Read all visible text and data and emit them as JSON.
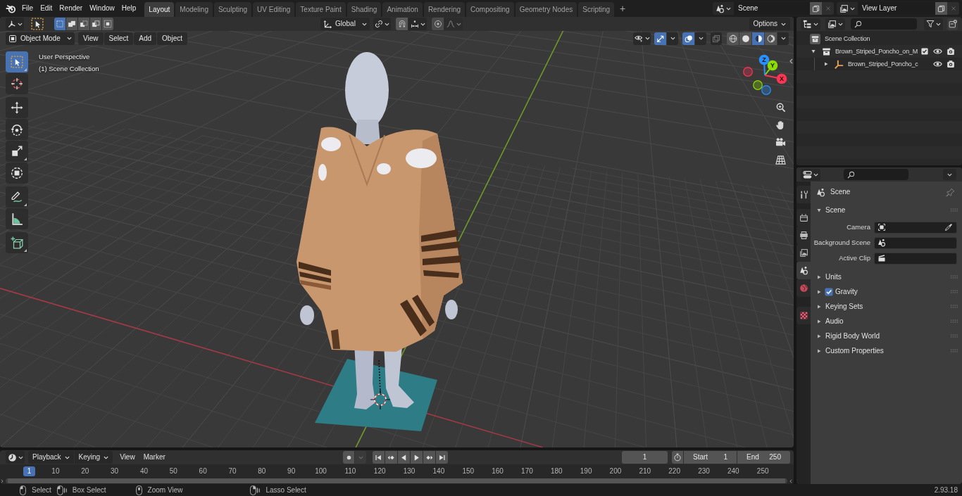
{
  "top_bar": {
    "menus": [
      "File",
      "Edit",
      "Render",
      "Window",
      "Help"
    ],
    "workspaces": [
      {
        "label": "Layout",
        "selected": true
      },
      {
        "label": "Modeling",
        "selected": false
      },
      {
        "label": "Sculpting",
        "selected": false
      },
      {
        "label": "UV Editing",
        "selected": false
      },
      {
        "label": "Texture Paint",
        "selected": false
      },
      {
        "label": "Shading",
        "selected": false
      },
      {
        "label": "Animation",
        "selected": false
      },
      {
        "label": "Rendering",
        "selected": false
      },
      {
        "label": "Compositing",
        "selected": false
      },
      {
        "label": "Geometry Nodes",
        "selected": false
      },
      {
        "label": "Scripting",
        "selected": false
      }
    ],
    "add_workspace": "+",
    "scene": "Scene",
    "view_layer": "View Layer"
  },
  "viewport": {
    "tool_header": {
      "select_modes": [
        {
          "kind": "set",
          "selected": true
        },
        {
          "kind": "extend",
          "selected": false
        },
        {
          "kind": "subtract",
          "selected": false
        },
        {
          "kind": "invert",
          "selected": false
        },
        {
          "kind": "intersect",
          "selected": false
        }
      ],
      "orientation": "Global",
      "options": "Options"
    },
    "header": {
      "mode": "Object Mode",
      "menus": [
        "View",
        "Select",
        "Add",
        "Object"
      ],
      "gizmos_on": true,
      "overlays_on": true,
      "xray_on": false,
      "shading": [
        {
          "kind": "wireframe",
          "selected": false
        },
        {
          "kind": "solid",
          "selected": false
        },
        {
          "kind": "material",
          "selected": true
        },
        {
          "kind": "rendered",
          "selected": false
        }
      ]
    },
    "tool_groups": [
      [
        {
          "kind": "select_box",
          "selected": true,
          "variants": true
        },
        {
          "kind": "cursor",
          "selected": false,
          "variants": false
        }
      ],
      [
        {
          "kind": "move",
          "selected": false,
          "variants": false
        },
        {
          "kind": "rotate",
          "selected": false,
          "variants": false
        },
        {
          "kind": "scale",
          "selected": false,
          "variants": true
        },
        {
          "kind": "transform",
          "selected": false,
          "variants": false
        }
      ],
      [
        {
          "kind": "annotate",
          "selected": false,
          "variants": true
        },
        {
          "kind": "measure",
          "selected": false,
          "variants": false
        }
      ],
      [
        {
          "kind": "add_cube",
          "selected": false,
          "variants": true
        }
      ]
    ],
    "info": [
      "User Perspective",
      "(1) Scene Collection"
    ],
    "axis_gizmo": {
      "x": "X",
      "y": "Y",
      "z": "Z"
    }
  },
  "outliner": {
    "root": {
      "label": "Scene Collection",
      "children": [
        {
          "kind": "collection",
          "label": "Brown_Striped_Poncho_on_M",
          "expanded": true,
          "checked": true,
          "children": [
            {
              "kind": "empty",
              "label": "Brown_Striped_Poncho_c",
              "expanded": false
            }
          ]
        }
      ]
    }
  },
  "properties": {
    "tab_groups": [
      [
        {
          "kind": "tool",
          "selected": false
        }
      ],
      [
        {
          "kind": "render",
          "selected": false
        },
        {
          "kind": "output",
          "selected": false
        },
        {
          "kind": "view_layer",
          "selected": false
        },
        {
          "kind": "scene",
          "selected": true
        },
        {
          "kind": "world",
          "selected": false
        }
      ],
      [
        {
          "kind": "texture",
          "selected": false
        }
      ]
    ],
    "context": "Scene",
    "panels": [
      {
        "title": "Scene",
        "expanded": true,
        "fields": [
          {
            "kind": "camera",
            "label": "Camera"
          },
          {
            "kind": "scene",
            "label": "Background Scene"
          },
          {
            "kind": "clip",
            "label": "Active Clip"
          }
        ]
      },
      {
        "title": "Units",
        "expanded": false
      },
      {
        "title": "Gravity",
        "expanded": false,
        "checked": true
      },
      {
        "title": "Keying Sets",
        "expanded": false
      },
      {
        "title": "Audio",
        "expanded": false
      },
      {
        "title": "Rigid Body World",
        "expanded": false
      },
      {
        "title": "Custom Properties",
        "expanded": false
      }
    ]
  },
  "timeline": {
    "dropdowns": [
      "Playback",
      "Keying"
    ],
    "menus": [
      "View",
      "Marker"
    ],
    "current_frame": "1",
    "start_label": "Start",
    "start": "1",
    "end_label": "End",
    "end": "250",
    "ruler": {
      "current": "1",
      "ticks": [
        "10",
        "20",
        "30",
        "40",
        "50",
        "60",
        "70",
        "80",
        "90",
        "100",
        "110",
        "120",
        "130",
        "140",
        "150",
        "160",
        "170",
        "180",
        "190",
        "200",
        "210",
        "220",
        "230",
        "240",
        "250"
      ]
    }
  },
  "status_bar": {
    "hints": [
      {
        "kind": "left_click",
        "label": "Select"
      },
      {
        "kind": "left_drag",
        "label": "Box Select"
      },
      {
        "kind": "middle",
        "label": "Zoom View"
      },
      {
        "kind": "right_drag",
        "label": "Lasso Select"
      }
    ],
    "version": "2.93.18"
  }
}
